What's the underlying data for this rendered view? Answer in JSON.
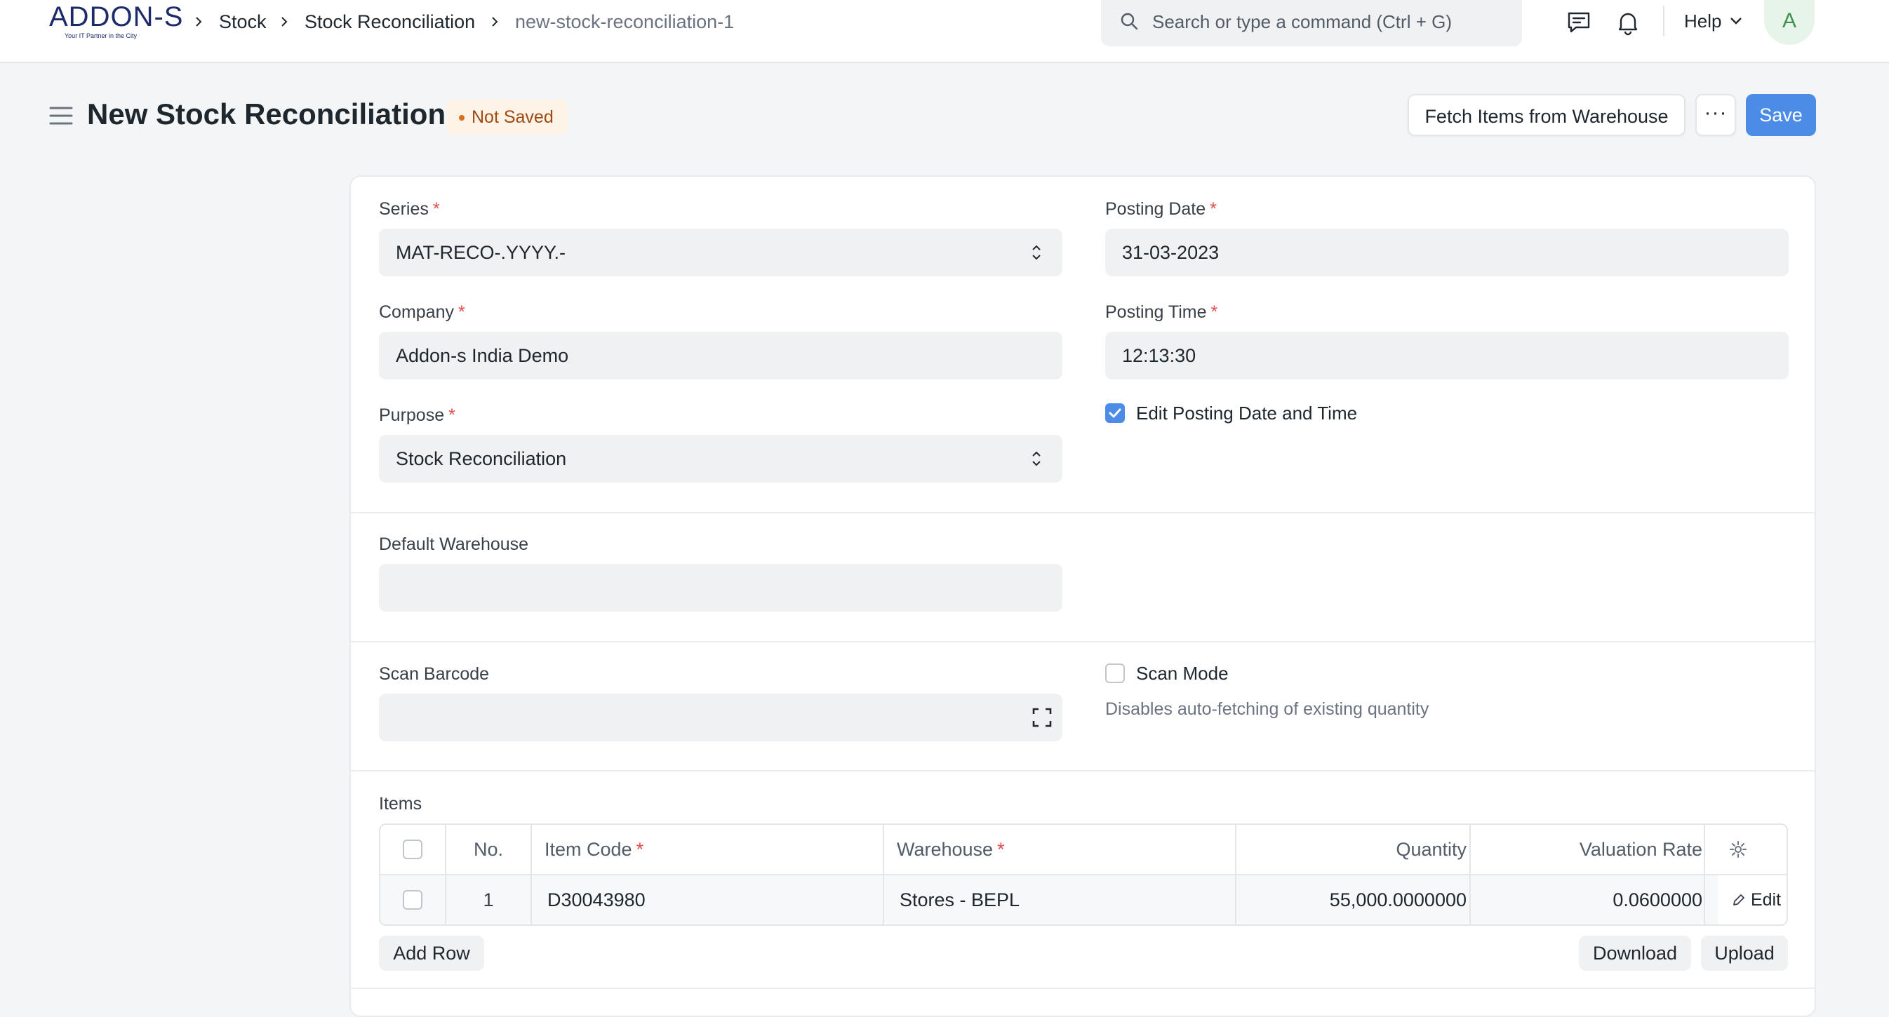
{
  "navbar": {
    "logo_text": "ADDON-S",
    "logo_tagline": "Your IT Partner in the City",
    "breadcrumbs": [
      "Stock",
      "Stock Reconciliation",
      "new-stock-reconciliation-1"
    ],
    "search_placeholder": "Search or type a command (Ctrl + G)",
    "help_label": "Help",
    "avatar_initial": "A"
  },
  "page": {
    "title": "New Stock Reconciliation",
    "status": "Not Saved",
    "actions": {
      "fetch_items": "Fetch Items from Warehouse",
      "more": "···",
      "save": "Save"
    }
  },
  "form": {
    "series": {
      "label": "Series",
      "value": "MAT-RECO-.YYYY.-"
    },
    "company": {
      "label": "Company",
      "value": "Addon-s India Demo"
    },
    "purpose": {
      "label": "Purpose",
      "value": "Stock Reconciliation"
    },
    "posting_date": {
      "label": "Posting Date",
      "value": "31-03-2023"
    },
    "posting_time": {
      "label": "Posting Time",
      "value": "12:13:30"
    },
    "edit_posting": {
      "label": "Edit Posting Date and Time",
      "checked": true
    },
    "default_warehouse": {
      "label": "Default Warehouse",
      "value": ""
    },
    "scan_barcode": {
      "label": "Scan Barcode",
      "value": ""
    },
    "scan_mode": {
      "label": "Scan Mode",
      "checked": false,
      "description": "Disables auto-fetching of existing quantity"
    },
    "required_marker": "*"
  },
  "items": {
    "label": "Items",
    "columns": {
      "no": "No.",
      "item_code": "Item Code",
      "warehouse": "Warehouse",
      "quantity": "Quantity",
      "valuation_rate": "Valuation Rate"
    },
    "rows": [
      {
        "no": "1",
        "item_code": "D30043980",
        "warehouse": "Stores - BEPL",
        "quantity": "55,000.0000000",
        "valuation_rate": "0.0600000",
        "edit_label": "Edit"
      }
    ],
    "add_row": "Add Row",
    "download": "Download",
    "upload": "Upload"
  },
  "colors": {
    "primary": "#4c8ce6",
    "status_badge_text": "#a04a12",
    "required": "#e24c4c"
  }
}
